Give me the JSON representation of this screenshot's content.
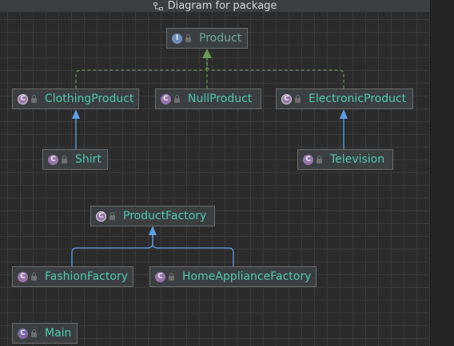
{
  "window": {
    "title": "Diagram for package"
  },
  "diagram": {
    "nodes": [
      {
        "id": "product",
        "label": "Product",
        "kind": "interface",
        "badge": "I"
      },
      {
        "id": "clothingproduct",
        "label": "ClothingProduct",
        "kind": "abstract",
        "badge": "C"
      },
      {
        "id": "nullproduct",
        "label": "NullProduct",
        "kind": "class",
        "badge": "C"
      },
      {
        "id": "electronicproduct",
        "label": "ElectronicProduct",
        "kind": "abstract",
        "badge": "C"
      },
      {
        "id": "shirt",
        "label": "Shirt",
        "kind": "class",
        "badge": "C"
      },
      {
        "id": "television",
        "label": "Television",
        "kind": "class",
        "badge": "C"
      },
      {
        "id": "productfactory",
        "label": "ProductFactory",
        "kind": "abstract",
        "badge": "C"
      },
      {
        "id": "fashionfactory",
        "label": "FashionFactory",
        "kind": "class",
        "badge": "C"
      },
      {
        "id": "homeappliancefactory",
        "label": "HomeApplianceFactory",
        "kind": "class",
        "badge": "C"
      },
      {
        "id": "main",
        "label": "Main",
        "kind": "class",
        "badge": "C"
      }
    ],
    "edges": [
      {
        "from": "clothingproduct",
        "to": "product",
        "type": "implements"
      },
      {
        "from": "nullproduct",
        "to": "product",
        "type": "implements"
      },
      {
        "from": "electronicproduct",
        "to": "product",
        "type": "implements"
      },
      {
        "from": "shirt",
        "to": "clothingproduct",
        "type": "extends"
      },
      {
        "from": "television",
        "to": "electronicproduct",
        "type": "extends"
      },
      {
        "from": "fashionfactory",
        "to": "productfactory",
        "type": "extends"
      },
      {
        "from": "homeappliancefactory",
        "to": "productfactory",
        "type": "extends"
      }
    ]
  },
  "colors": {
    "implements": "#6a9955",
    "extends": "#5c9ee6",
    "class_text": "#4ec9b0",
    "interface_text": "#6aab9c"
  },
  "icons": {
    "title": "diagram-icon",
    "lock": "lock-icon"
  }
}
